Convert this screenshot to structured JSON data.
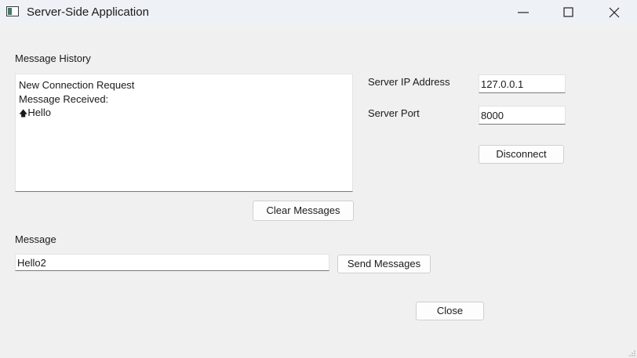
{
  "window": {
    "title": "Server-Side Application"
  },
  "history": {
    "label": "Message History",
    "lines": [
      "New Connection Request",
      "Message Received:",
      "Hello"
    ],
    "arrow_glyph": "🡅"
  },
  "server": {
    "ip_label": "Server IP Address",
    "ip_value": "127.0.0.1",
    "port_label": "Server Port",
    "port_value": "8000",
    "disconnect_label": "Disconnect"
  },
  "actions": {
    "clear_label": "Clear Messages",
    "send_label": "Send Messages",
    "close_label": "Close"
  },
  "message": {
    "label": "Message",
    "value": "Hello2"
  }
}
